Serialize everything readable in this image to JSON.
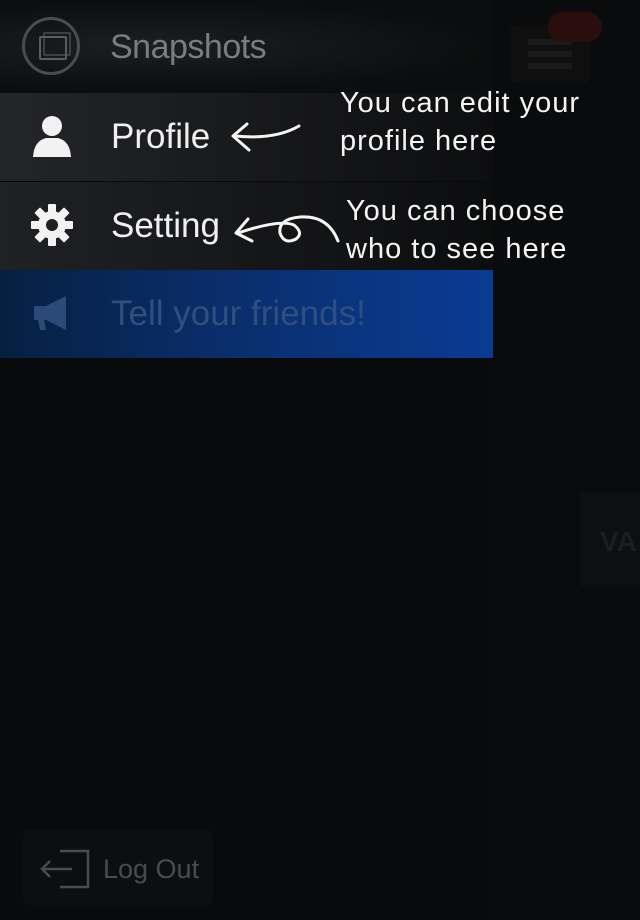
{
  "app": {
    "title": "Snapshots"
  },
  "menu": {
    "items": [
      {
        "label": "Profile",
        "icon": "person-icon"
      },
      {
        "label": "Setting",
        "icon": "gear-icon"
      },
      {
        "label": "Tell your friends!",
        "icon": "megaphone-icon"
      }
    ],
    "logout_label": "Log Out"
  },
  "hints": {
    "profile": "You can edit your profile here",
    "profile_line1": "You can edit your",
    "profile_line2": "profile here",
    "setting": "You can choose who to see here",
    "setting_line1": "You can choose",
    "setting_line2": "who to see here"
  },
  "background": {
    "side_card_text": "VA"
  },
  "colors": {
    "menu_bg": "#090a0b",
    "highlight_blue": "#0a3b93",
    "hint_text": "#f4f4f4"
  }
}
